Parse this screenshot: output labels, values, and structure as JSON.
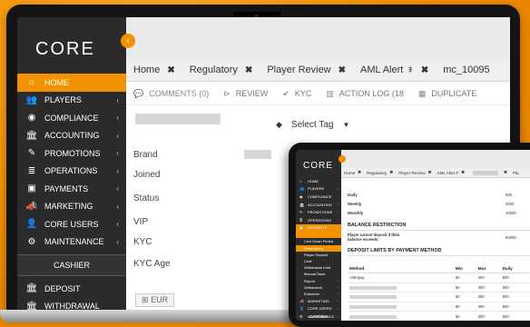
{
  "laptop": {
    "logo": "CORE",
    "collapse_icon": "‹",
    "nav": [
      {
        "icon": "⌂",
        "label": "HOME",
        "active": true,
        "chev": ""
      },
      {
        "icon": "👥",
        "label": "PLAYERS",
        "chev": "‹"
      },
      {
        "icon": "◉",
        "label": "COMPLIANCE",
        "chev": "‹"
      },
      {
        "icon": "🏛",
        "label": "ACCOUNTING",
        "chev": "‹"
      },
      {
        "icon": "✎",
        "label": "PROMOTIONS",
        "chev": "‹"
      },
      {
        "icon": "≣",
        "label": "OPERATIONS",
        "chev": "‹"
      },
      {
        "icon": "▣",
        "label": "PAYMENTS",
        "chev": "‹"
      },
      {
        "icon": "📣",
        "label": "MARKETING",
        "chev": "‹"
      },
      {
        "icon": "👤",
        "label": "CORE USERS",
        "chev": "‹"
      },
      {
        "icon": "⚙",
        "label": "MAINTENANCE",
        "chev": "‹"
      }
    ],
    "section_label": "CASHIER",
    "cashier_items": [
      {
        "icon": "🏛",
        "label": "DEPOSIT"
      },
      {
        "icon": "🏛",
        "label": "WITHDRAWAL"
      }
    ],
    "tabs": [
      {
        "label": "Home",
        "close": "✖"
      },
      {
        "label": "Regulatory",
        "close": "✖"
      },
      {
        "label": "Player Review",
        "close": "✖"
      },
      {
        "label": "AML Alert",
        "pin": "⇞",
        "close": "✖"
      },
      {
        "label": "mc_10095",
        "close": ""
      }
    ],
    "subtabs": [
      {
        "icon": "💬",
        "label": "COMMENTS (0)"
      },
      {
        "icon": "⊳",
        "label": "REVIEW"
      },
      {
        "icon": "✔",
        "label": "KYC"
      },
      {
        "icon": "▥",
        "label": "ACTION LOG (18"
      },
      {
        "icon": "▦",
        "label": "DUPLICATE"
      }
    ],
    "select_tag": {
      "icon": "◆",
      "label": "Select Tag",
      "caret": "▼"
    },
    "fields": [
      "Brand",
      "Joined",
      "Status",
      "VIP",
      "KYC",
      "KYC Age"
    ],
    "currency": "EUR"
  },
  "tablet": {
    "logo": "CORE",
    "nav": [
      {
        "icon": "⌂",
        "label": "HOME",
        "chev": ""
      },
      {
        "icon": "👥",
        "label": "PLAYERS",
        "chev": "‹"
      },
      {
        "icon": "◉",
        "label": "COMPLIANCE",
        "chev": "‹"
      },
      {
        "icon": "🏛",
        "label": "ACCOUNTING",
        "chev": "‹"
      },
      {
        "icon": "✎",
        "label": "PROMOTIONS",
        "chev": "‹"
      },
      {
        "icon": "≣",
        "label": "OPERATIONS",
        "chev": "‹"
      },
      {
        "icon": "▣",
        "label": "PAYMENTS",
        "chev": "‹",
        "active": true
      }
    ],
    "payments_sub": [
      {
        "label": "",
        "hl": true
      },
      {
        "label": "Cool Down Period",
        "hl": false
      },
      {
        "label": "Restrictions",
        "hl": true
      },
      {
        "label": "Player Deposit",
        "hl": false
      },
      {
        "label": "Limit",
        "hl": false
      },
      {
        "label": "Withdrawal Limit",
        "hl": false
      },
      {
        "label": "Manual Bank",
        "hl": false
      },
      {
        "label": "Report",
        "chev": "‹"
      },
      {
        "label": "Withdrawal",
        "chev": "‹"
      },
      {
        "label": "Entsorber",
        "chev": "‹"
      }
    ],
    "nav_after": [
      {
        "icon": "📣",
        "label": "MARKETING",
        "chev": "‹"
      },
      {
        "icon": "👤",
        "label": "CORE USERS",
        "chev": "‹"
      },
      {
        "icon": "⚙",
        "label": "MAINTENANCE",
        "chev": "‹"
      }
    ],
    "section_label": "CASHIER",
    "tabs": [
      {
        "label": "Home",
        "close": "✖"
      },
      {
        "label": "Regulatory",
        "close": "✖"
      },
      {
        "label": "Player Review",
        "close": "✖"
      },
      {
        "label": "AML Alert F",
        "close": "✖"
      },
      {
        "label": "",
        "close": "✖",
        "gray": true
      },
      {
        "label": "Pla",
        "close": ""
      }
    ],
    "limits": [
      {
        "label": "Daily",
        "value": "500"
      },
      {
        "label": "Weekly",
        "value": "3000"
      },
      {
        "label": "Monthly",
        "value": "10000"
      }
    ],
    "balance_heading": "BALANCE RESTRICTION",
    "balance_note": "Player cannot deposit if their balance exceeds:",
    "balance_value": "80000",
    "deposit_heading": "DEPOSIT LIMITS BY PAYMENT METHOD",
    "table": {
      "headers": [
        "Method",
        "Min",
        "Max",
        "Daily"
      ],
      "rows": [
        {
          "method": "Astropay",
          "min": "50",
          "max": "300",
          "daily": "500"
        },
        {
          "method": "",
          "min": "50",
          "max": "300",
          "daily": "500"
        },
        {
          "method": "",
          "min": "50",
          "max": "300",
          "daily": "500"
        },
        {
          "method": "",
          "min": "50",
          "max": "300",
          "daily": "500"
        },
        {
          "method": "",
          "min": "50",
          "max": "300",
          "daily": "500"
        },
        {
          "method": "",
          "min": "50",
          "max": "300",
          "daily": "500"
        },
        {
          "method": "",
          "min": "50",
          "max": "300",
          "daily": "500"
        }
      ]
    }
  }
}
